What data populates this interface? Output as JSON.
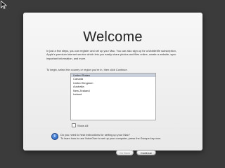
{
  "window": {
    "title": "Welcome",
    "intro": "In just a few steps, you can register and set up your Mac. You can also sign up for a MobileMe subscription, Apple's premium Internet service which lets you easily share photos and files online, create a website, sync important information, and more.",
    "prompt": "To begin, select the country or region you're in, then click Continue."
  },
  "countries": {
    "items": [
      "United States",
      "Canada",
      "United Kingdom",
      "Australia",
      "New Zealand",
      "Ireland"
    ],
    "selected": "United States"
  },
  "show_all_label": "Show All",
  "help": {
    "line1": "Do you need to hear instructions for setting up your Mac?",
    "line2": "To learn how to use VoiceOver to set up your computer, press the Escape key now."
  },
  "buttons": {
    "back_label": "Go Back",
    "continue_label": "Continue"
  },
  "colors": {
    "desktop": "#3b3b3b",
    "selection": "#c9d0dc",
    "help_accent": "#1b5bbf"
  }
}
